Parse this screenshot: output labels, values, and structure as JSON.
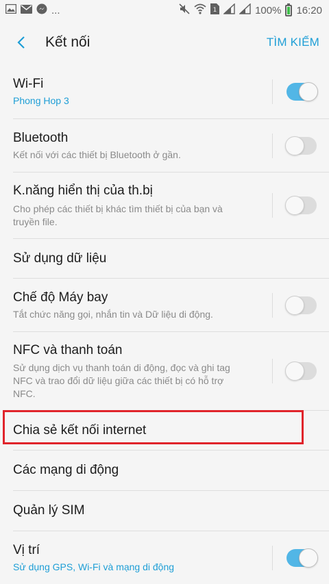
{
  "status_bar": {
    "notif_more": "...",
    "battery_pct": "100%",
    "time": "16:20"
  },
  "header": {
    "title": "Kết nối",
    "search_label": "TÌM KIẾM"
  },
  "items": [
    {
      "title": "Wi-Fi",
      "subtitle": "Phong Hop 3",
      "toggle": "on"
    },
    {
      "title": "Bluetooth",
      "subtitle": "Kết nối với các thiết bị Bluetooth ở gần.",
      "toggle": "off"
    },
    {
      "title": "K.năng hiển thị của th.bị",
      "subtitle_line1": "Cho phép các thiết bị khác tìm thiết bị của bạn và",
      "subtitle_line2": "truyền file.",
      "toggle": "off"
    },
    {
      "title": "Sử dụng dữ liệu"
    },
    {
      "title": "Chế độ Máy bay",
      "subtitle": "Tắt chức năng gọi, nhắn tin và Dữ liệu di động.",
      "toggle": "off"
    },
    {
      "title": "NFC và thanh toán",
      "subtitle_line1": "Sử dụng dịch vụ thanh toán di động, đọc và ghi tag",
      "subtitle_line2": "NFC và trao đổi dữ liệu giữa các thiết bị có hỗ trợ",
      "subtitle_line3": "NFC.",
      "toggle": "off"
    },
    {
      "title": "Chia sẻ kết nối internet",
      "highlighted": true
    },
    {
      "title": "Các mạng di động"
    },
    {
      "title": "Quản lý SIM"
    },
    {
      "title": "Vị trí",
      "subtitle": "Sử dụng GPS, Wi-Fi và mạng di động",
      "toggle": "on"
    }
  ],
  "colors": {
    "accent": "#1e9ed6",
    "toggle_on": "#52b6e6",
    "highlight": "#e0242b"
  }
}
